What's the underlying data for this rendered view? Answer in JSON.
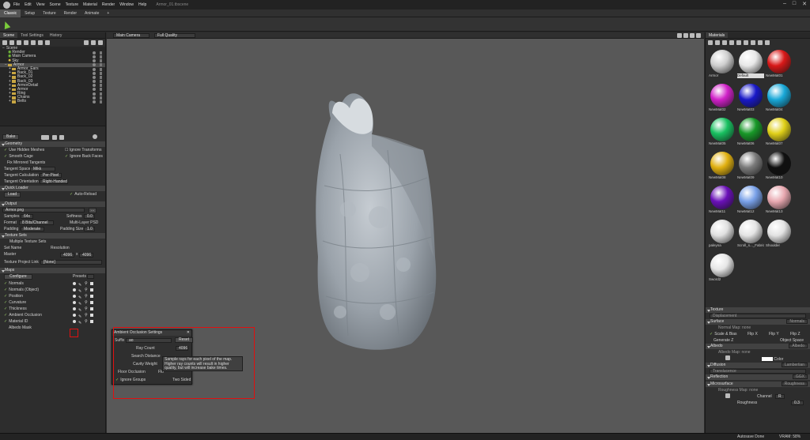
{
  "app": {
    "title": "Armor_01.tbscene",
    "menus": [
      "File",
      "Edit",
      "View",
      "Scene",
      "Texture",
      "Material",
      "Render",
      "Window",
      "Help"
    ]
  },
  "tabs": [
    "Classic",
    "Setup",
    "Texture",
    "Render",
    "Animate",
    "+"
  ],
  "left_panel": {
    "tabs": [
      "Scene",
      "Tool Settings",
      "History"
    ],
    "tree": {
      "root": "Scene",
      "children": [
        "Render",
        "Main Camera",
        "Sky",
        "Armor"
      ],
      "armor_children": [
        "Armor_Ears",
        "Back_01",
        "Back_02",
        "Back_03",
        "ArmorDetail",
        "Armor",
        "Ring",
        "Chains",
        "Belts"
      ]
    },
    "bake_label": "Bake",
    "geometry": {
      "header": "Geometry",
      "use_hidden": "Use Hidden Meshes",
      "ignore_transforms": "Ignore Transforms",
      "smooth_cage": "Smooth Cage",
      "ignore_back_faces": "Ignore Back Faces",
      "fix_mirrored": "Fix Mirrored Tangents",
      "tangent_space_label": "Tangent Space",
      "tangent_space_value": "Mikk",
      "tangent_calc_label": "Tangent Calculation",
      "tangent_calc_value": "Per-Pixel",
      "tangent_orient_label": "Tangent Orientation",
      "tangent_orient_value": "Right-Handed"
    },
    "quick_loader": {
      "header": "Quick Loader",
      "load": "Load",
      "auto_reload": "Auto-Reload"
    },
    "output": {
      "header": "Output",
      "file": "Armor.png",
      "browse": "...",
      "samples_label": "Samples",
      "samples_value": "64x",
      "softness_label": "Softness",
      "softness_value": "0.0",
      "format_label": "Format",
      "format_value": "8 Bits/Channel",
      "multilayer": "Multi-Layer PSD",
      "padding_label": "Padding",
      "padding_value": "Moderate",
      "padding_size_label": "Padding Size",
      "padding_size_value": "1.0"
    },
    "texture_sets": {
      "header": "Texture Sets",
      "multiple": "Multiple Texture Sets",
      "set_name": "Set Name",
      "resolution": "Resolution",
      "master": "Master",
      "res_w": "4096",
      "x": "x",
      "res_h": "4096",
      "project_link_label": "Texture Project Link",
      "project_link_value": "[None]"
    },
    "maps": {
      "header": "Maps",
      "configure": "Configure",
      "presets": "Presets",
      "items": [
        "Normals",
        "Normals (Object)",
        "Position",
        "Curvature",
        "Thickness",
        "Ambient Occlusion",
        "Material ID",
        "Albedo Mask"
      ]
    }
  },
  "viewport": {
    "camera": "Main Camera",
    "quality": "Full Quality"
  },
  "ao_dialog": {
    "title": "Ambient Occlusion Settings",
    "suffix_label": "Suffix",
    "suffix_value": "ao",
    "reset": "Reset",
    "ray_count_label": "Ray Count",
    "ray_count_value": "4096",
    "search_distance": "Search Distance",
    "cavity_weight": "Cavity Weight",
    "floor_occlusion": "Floor Occlusion",
    "floor_short": "Flo",
    "ignore_groups": "Ignore Groups",
    "two_sided": "Two Sided"
  },
  "tooltip": {
    "text": "Sample rays for each pixel of the map. Higher ray counts will result in higher quality, but will increase bake times."
  },
  "right_panel": {
    "header": "Materials",
    "materials": [
      {
        "name": "Armor",
        "color": "#cfcfcf"
      },
      {
        "name": "Default",
        "color": "#e8e8e8"
      },
      {
        "name": "NewMat01",
        "color": "#d81818"
      },
      {
        "name": "NewMat02",
        "color": "#d020c8"
      },
      {
        "name": "NewMat03",
        "color": "#1818c8"
      },
      {
        "name": "NewMat04",
        "color": "#18a8d8"
      },
      {
        "name": "NewMat05",
        "color": "#18c060"
      },
      {
        "name": "NewMat06",
        "color": "#189828"
      },
      {
        "name": "NewMat07",
        "color": "#e0d018"
      },
      {
        "name": "NewMat08",
        "color": "#e0b010"
      },
      {
        "name": "NewMat09",
        "color": "#7a7a7a"
      },
      {
        "name": "NewMat10",
        "color": "#101010"
      },
      {
        "name": "NewMat11",
        "color": "#6a10b8"
      },
      {
        "name": "NewMat12",
        "color": "#78a0e8"
      },
      {
        "name": "NewMat13",
        "color": "#e8a8b0"
      },
      {
        "name": "paleyna",
        "color": "#e0e0e0"
      },
      {
        "name": "Scroll_s..._Fabric",
        "color": "#e4e4e4"
      },
      {
        "name": "Shoulder",
        "color": "#e2e2e2"
      },
      {
        "name": "Sword2",
        "color": "#e6e6e6"
      }
    ],
    "properties": {
      "texture_header": "Texture",
      "displacement": "Displacement",
      "surface_header": "Surface",
      "surface_value": "Normals",
      "normal_map_label": "Normal Map:",
      "normal_map_value": "none",
      "scale_bias": "Scale & Bias",
      "flip_x": "Flip X",
      "flip_y": "Flip Y",
      "flip_z": "Flip Z",
      "generate_z": "Generate Z",
      "object_space": "Object Space",
      "albedo_header": "Albedo",
      "albedo_value": "Albedo",
      "albedo_map_label": "Albedo Map:",
      "albedo_map_value": "none",
      "color": "Color",
      "diffusion_header": "Diffusion",
      "diffusion_value": "Lambertian",
      "translucence": "Translucence",
      "reflection_header": "Reflection",
      "reflection_value": "GGX",
      "microsurface_header": "Microsurface",
      "microsurface_value": "Roughness",
      "roughness_map_label": "Roughness Map:",
      "roughness_map_value": "none",
      "channel_label": "Channel",
      "channel_value": "R",
      "roughness_label": "Roughness",
      "roughness_value": "0.3"
    }
  },
  "status": {
    "autosave": "Autosave Done",
    "vram": "VRAM: 58%"
  }
}
